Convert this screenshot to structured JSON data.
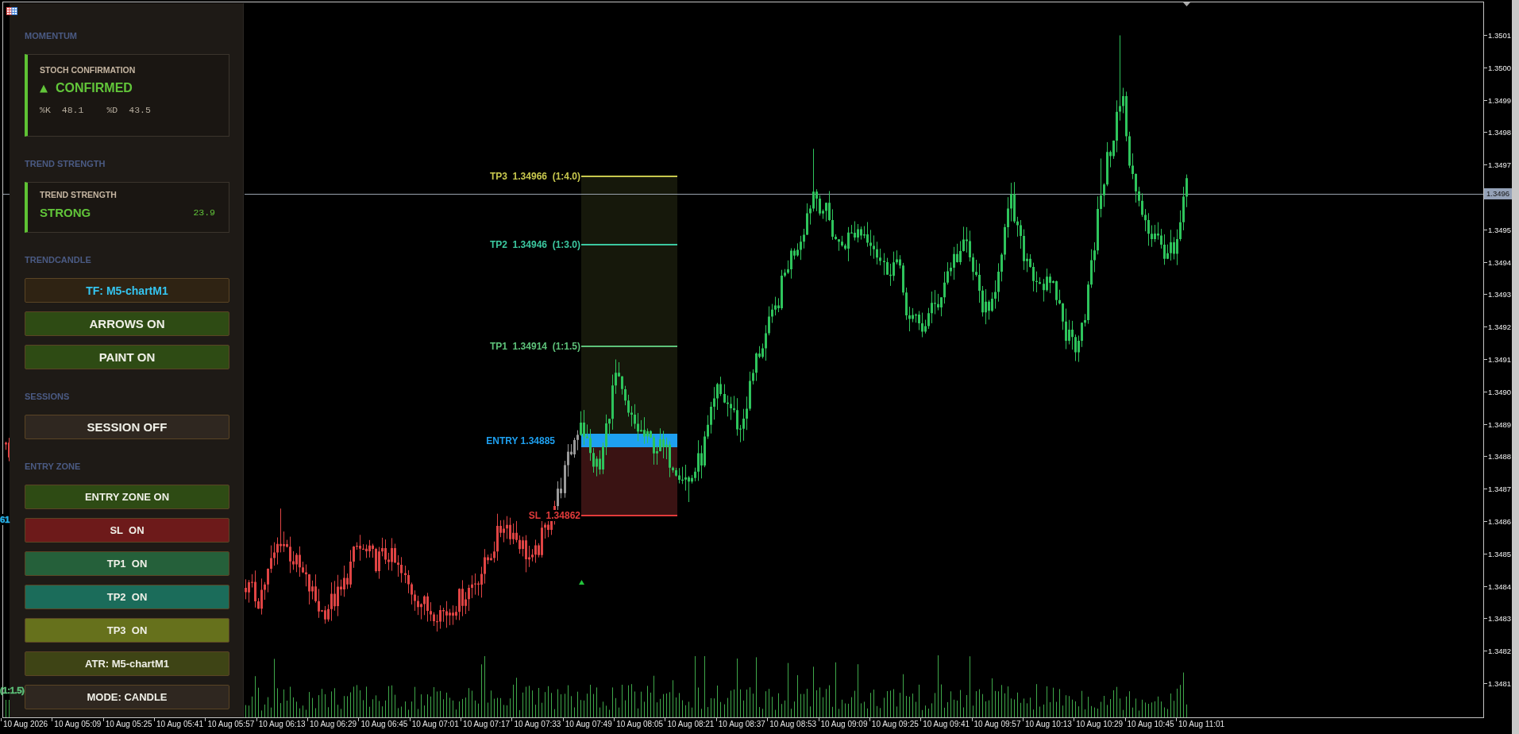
{
  "chart": {
    "levels": [
      {
        "kind": "line",
        "label": "TP3  1.34966  (1:4.0)",
        "color": "#c8c84e"
      },
      {
        "kind": "line",
        "label": "TP2  1.34946  (1:3.0)",
        "color": "#3cc8a0"
      },
      {
        "kind": "line",
        "label": "TP1  1.34914  (1:1.5)",
        "color": "#5ec27a"
      },
      {
        "kind": "band",
        "label": "ENTRY 1.34885",
        "color": "#1ea0f0"
      },
      {
        "kind": "line",
        "label": "SL  1.34862",
        "color": "#e23b3b"
      }
    ],
    "edge_labels": [
      {
        "text": "61",
        "color": "#28b4ec"
      },
      {
        "text": "(1:1.5)",
        "color": "#5ec27a"
      }
    ]
  },
  "panel": {
    "sections": [
      {
        "kind": "stoch_card",
        "title": "MOMENTUM",
        "card": {
          "heading": "STOCH CONFIRMATION",
          "arrow": "▲",
          "status": "CONFIRMED",
          "stats": [
            {
              "label": "%K",
              "value": "48.1"
            },
            {
              "label": "%D",
              "value": "43.5"
            }
          ]
        }
      },
      {
        "kind": "strength_card",
        "title": "TREND STRENGTH",
        "card": {
          "heading": "TREND STRENGTH",
          "status": "STRONG",
          "value": "23.9"
        }
      },
      {
        "kind": "large_buttons",
        "title": "TRENDCANDLE",
        "buttons": [
          {
            "kind": "accent",
            "label": "TF: M5-chartM1",
            "color": "#2f2313"
          },
          {
            "kind": "plain",
            "label": "ARROWS ON",
            "color": "#2e4b14"
          },
          {
            "kind": "plain",
            "label": "PAINT ON",
            "color": "#2e4b14"
          }
        ]
      },
      {
        "kind": "large_buttons",
        "title": "SESSIONS",
        "buttons": [
          {
            "kind": "plain",
            "label": "SESSION OFF",
            "color": "#2f2720"
          }
        ]
      },
      {
        "kind": "small_buttons",
        "title": "ENTRY ZONE",
        "buttons": [
          {
            "kind": "plain",
            "label": "ENTRY ZONE ON",
            "color": "#2e4b14"
          },
          {
            "kind": "plain",
            "label": "SL  ON",
            "color": "#6d1a1a"
          },
          {
            "kind": "plain",
            "label": "TP1  ON",
            "color": "#25603a"
          },
          {
            "kind": "plain",
            "label": "TP2  ON",
            "color": "#1b6c5a"
          },
          {
            "kind": "plain",
            "label": "TP3  ON",
            "color": "#66711c"
          },
          {
            "kind": "plain",
            "label": "ATR: M5-chartM1",
            "color": "#3e4415"
          },
          {
            "kind": "plain",
            "label": "MODE: CANDLE",
            "color": "#2f2720"
          }
        ]
      }
    ]
  },
  "price_axis": {
    "ticks_above": [
      "1.3501",
      "1.3500",
      "1.3499",
      "1.3498",
      "1.3497"
    ],
    "current": "1.3496",
    "ticks_below": [
      "1.3495",
      "1.3494",
      "1.3493",
      "1.3492",
      "1.3491",
      "1.3490",
      "1.3489",
      "1.3488",
      "1.3487",
      "1.3486",
      "1.3485",
      "1.3484",
      "1.3483",
      "1.3482",
      "1.3481"
    ]
  },
  "time_axis": {
    "labels": [
      "10 Aug 2026",
      "10 Aug 05:09",
      "10 Aug 05:25",
      "10 Aug 05:41",
      "10 Aug 05:57",
      "10 Aug 06:13",
      "10 Aug 06:29",
      "10 Aug 06:45",
      "10 Aug 07:01",
      "10 Aug 07:17",
      "10 Aug 07:33",
      "10 Aug 07:49",
      "10 Aug 08:05",
      "10 Aug 08:21",
      "10 Aug 08:37",
      "10 Aug 08:53",
      "10 Aug 09:09",
      "10 Aug 09:25",
      "10 Aug 09:41",
      "10 Aug 09:57",
      "10 Aug 10:13",
      "10 Aug 10:29",
      "10 Aug 10:45",
      "10 Aug 11:01"
    ]
  }
}
